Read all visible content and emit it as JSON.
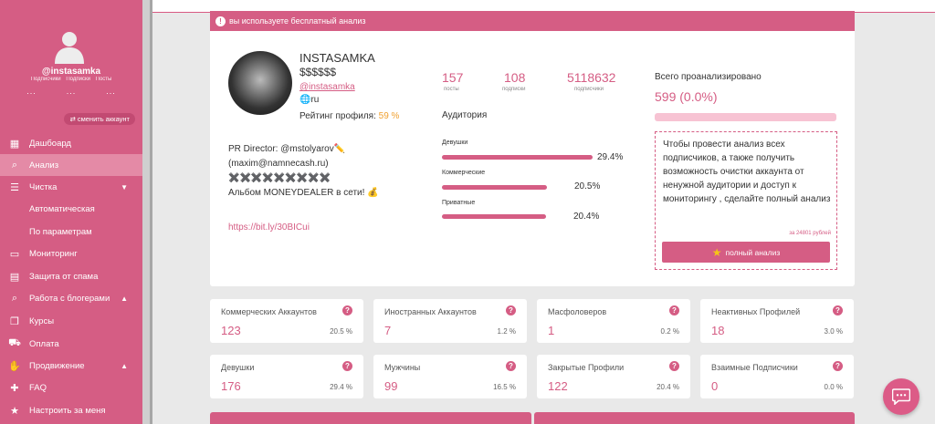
{
  "sidebar": {
    "username": "@instasamka",
    "stat_labels": [
      "Подписчики",
      "Подписки",
      "Посты"
    ],
    "stat_values": [
      "...",
      "...",
      "..."
    ],
    "change_account": "сменить аккаунт",
    "items": [
      {
        "label": "Дашбоард",
        "icon": "dashboard-icon"
      },
      {
        "label": "Анализ",
        "icon": "search-icon"
      },
      {
        "label": "Чистка",
        "icon": "list-icon"
      },
      {
        "label": "Автоматическая"
      },
      {
        "label": "По параметрам"
      },
      {
        "label": "Мониторинг",
        "icon": "card-icon"
      },
      {
        "label": "Защита от спама",
        "icon": "shield-file-icon"
      },
      {
        "label": "Работа с блогерами",
        "icon": "search-user-icon"
      },
      {
        "label": "Курсы",
        "icon": "copy-icon"
      },
      {
        "label": "Оплата",
        "icon": "cart-icon"
      },
      {
        "label": "Продвижение",
        "icon": "handshake-icon"
      },
      {
        "label": "FAQ",
        "icon": "puzzle-icon"
      },
      {
        "label": "Настроить за меня",
        "icon": "star-icon"
      }
    ]
  },
  "banner": {
    "text": "вы используете бесплатный анализ"
  },
  "profile": {
    "name": "INSTASAMKA",
    "money": "$$$$$$",
    "handle": "@instasamka",
    "lang": "ru",
    "rating_label": "Рейтинг профиля:",
    "rating_value": "59 %",
    "bio": [
      "PR Director: @mstolyarov✏️",
      "(maxim@namnecash.ru)",
      "✖️✖️✖️✖️✖️✖️✖️✖️✖️",
      "Альбом MONEYDEALER в сети! 💰"
    ],
    "link": "https://bit.ly/30BICui"
  },
  "counts": [
    {
      "value": "157",
      "label": "посты"
    },
    {
      "value": "108",
      "label": "подписки"
    },
    {
      "value": "5118632",
      "label": "подписчики"
    }
  ],
  "audience": {
    "title": "Аудитория",
    "items": [
      {
        "label": "Девушки",
        "value": "29.4%",
        "fraction": 0.294
      },
      {
        "label": "Коммерческие",
        "value": "20.5%",
        "fraction": 0.205
      },
      {
        "label": "Приватные",
        "value": "20.4%",
        "fraction": 0.204
      }
    ]
  },
  "total": {
    "label": "Всего проанализировано",
    "value": "599 (0.0%)"
  },
  "offer": {
    "text": "Чтобы провести анализ всех подписчиков, а также получить возможность очистки аккаунта от ненужной аудитории и доступ к мониторингу , сделайте полный анализ",
    "price": "за 24801 рублей",
    "button": "полный анализ"
  },
  "stats": [
    {
      "label": "Коммерческих Аккаунтов",
      "value": "123",
      "percent": "20.5 %"
    },
    {
      "label": "Иностранных Аккаунтов",
      "value": "7",
      "percent": "1.2 %"
    },
    {
      "label": "Масфоловеров",
      "value": "1",
      "percent": "0.2 %"
    },
    {
      "label": "Неактивных Профилей",
      "value": "18",
      "percent": "3.0 %"
    },
    {
      "label": "Девушки",
      "value": "176",
      "percent": "29.4 %"
    },
    {
      "label": "Мужчины",
      "value": "99",
      "percent": "16.5 %"
    },
    {
      "label": "Закрытые Профили",
      "value": "122",
      "percent": "20.4 %"
    },
    {
      "label": "Взаимные Подписчики",
      "value": "0",
      "percent": "0.0 %"
    }
  ],
  "colors": {
    "accent": "#d55d84",
    "rating": "#f0a030",
    "bar_light": "#f7c3d3"
  }
}
